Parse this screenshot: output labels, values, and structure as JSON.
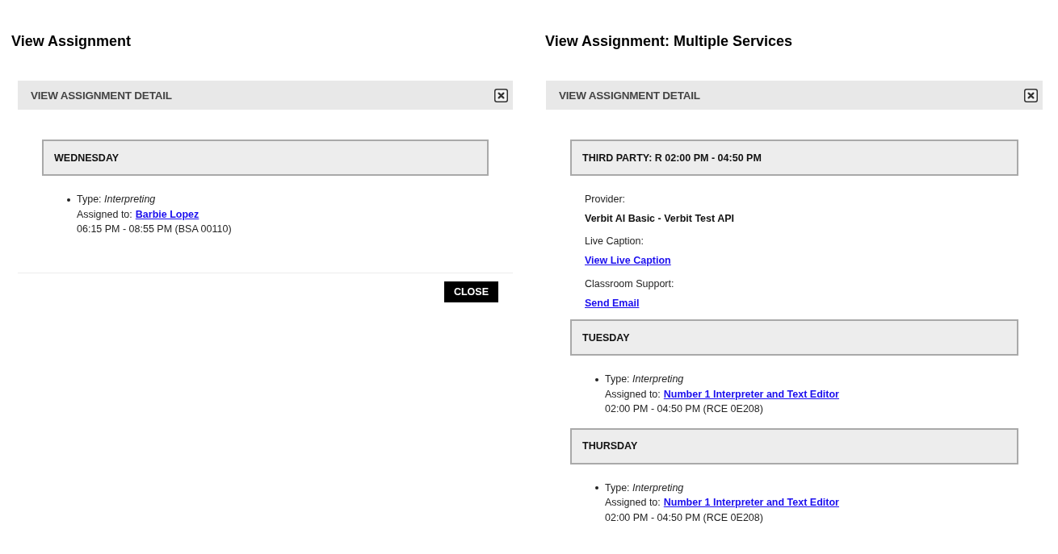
{
  "panels": [
    {
      "heading": "View Assignment",
      "modal": {
        "title": "VIEW ASSIGNMENT DETAIL",
        "sections": [
          {
            "kind": "assignments",
            "title": "WEDNESDAY",
            "items": [
              {
                "type_line": "Type: *Interpreting*",
                "assigned_label": "Assigned to:",
                "assignee": "Barbie Lopez",
                "time": "06:15 PM - 08:55 PM (BSA 00110)"
              }
            ]
          }
        ],
        "footer_button": "CLOSE"
      }
    },
    {
      "heading": "View Assignment: Multiple Services",
      "modal": {
        "title": "VIEW ASSIGNMENT DETAIL",
        "sections": [
          {
            "kind": "service",
            "title": "THIRD PARTY: R 02:00 PM - 04:50 PM",
            "fields": [
              {
                "kind": "text",
                "label": "Provider:",
                "value": "Verbit AI Basic - Verbit Test API"
              },
              {
                "kind": "link",
                "label": "Live Caption:",
                "value": "View Live Caption"
              },
              {
                "kind": "link",
                "label": "Classroom Support:",
                "value": "Send Email"
              }
            ]
          },
          {
            "kind": "assignments",
            "title": "TUESDAY",
            "items": [
              {
                "type_line": "Type: *Interpreting*",
                "assigned_label": "Assigned to:",
                "assignee": "Number 1 Interpreter and Text Editor",
                "time": "02:00 PM - 04:50 PM (RCE 0E208)"
              }
            ]
          },
          {
            "kind": "assignments",
            "title": "THURSDAY",
            "items": [
              {
                "type_line": "Type: *Interpreting*",
                "assigned_label": "Assigned to:",
                "assignee": "Number 1 Interpreter and Text Editor",
                "time": "02:00 PM - 04:50 PM (RCE 0E208)"
              }
            ]
          }
        ]
      }
    }
  ]
}
